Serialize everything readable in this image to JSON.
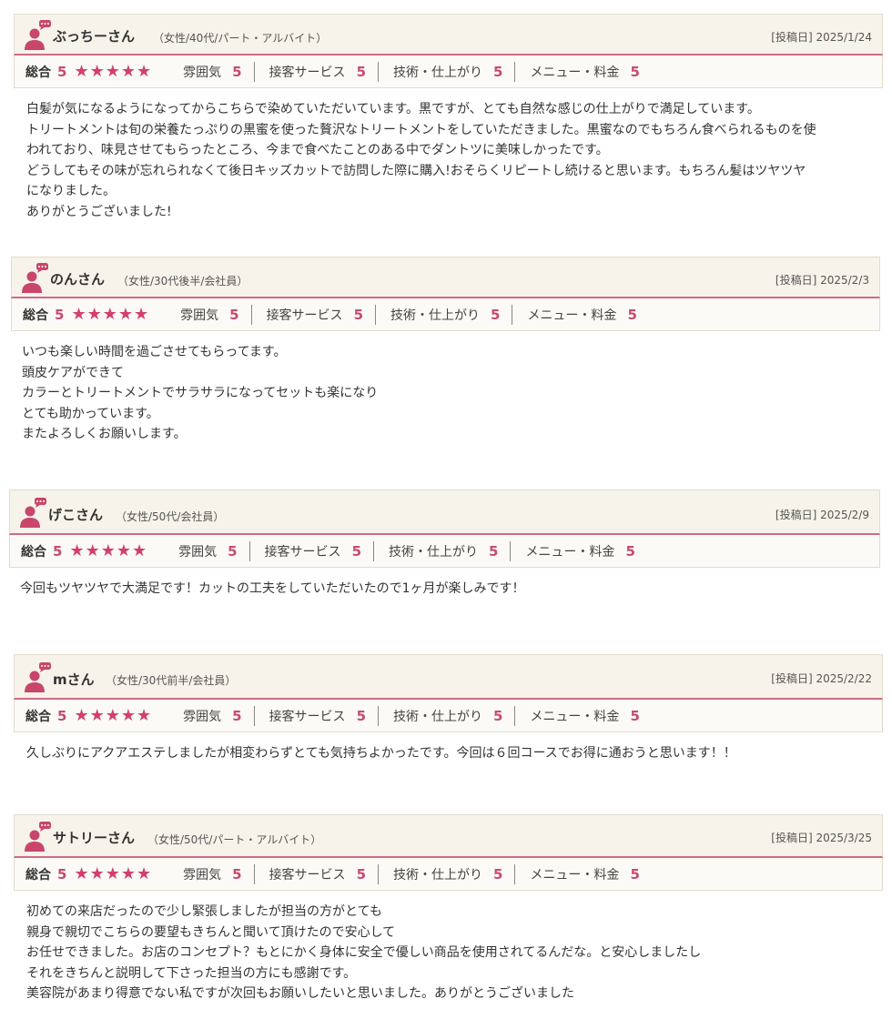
{
  "theme": {
    "accent": "#d06a85",
    "star": "#d23f6d",
    "header_bg": "#f7f3ea"
  },
  "labels": {
    "overall": "総合",
    "atmosphere": "雰囲気",
    "service": "接客サービス",
    "technique": "技術・仕上がり",
    "menu_price": "メニュー・料金",
    "posted_prefix": "[投稿日]",
    "stars": "★★★★★"
  },
  "reviews": [
    {
      "name": "ぶっちーさん",
      "meta": "（女性/40代/パート・アルバイト）",
      "date": "2025/1/24",
      "overall": "5",
      "atmosphere": "5",
      "service": "5",
      "technique": "5",
      "menu_price": "5",
      "lines": [
        "白髪が気になるようになってからこちらで染めていただいています。黒ですが、とても自然な感じの仕上がりで満足しています。",
        "トリートメントは旬の栄養たっぷりの黒蜜を使った贅沢なトリートメントをしていただきました。黒蜜なのでもちろん食べられるものを使",
        "われており、味見させてもらったところ、今まで食べたことのある中でダントツに美味しかったです。",
        "どうしてもその味が忘れられなくて後日キッズカットで訪問した際に購入!おそらくリピートし続けると思います。もちろん髪はツヤツヤ",
        "になりました。",
        "ありがとうございました!"
      ]
    },
    {
      "name": "のんさん",
      "meta": "（女性/30代後半/会社員）",
      "date": "2025/2/3",
      "overall": "5",
      "atmosphere": "5",
      "service": "5",
      "technique": "5",
      "menu_price": "5",
      "lines": [
        "いつも楽しい時間を過ごさせてもらってます。",
        "頭皮ケアができて",
        "カラーとトリートメントでサラサラになってセットも楽になり",
        "とても助かっています。",
        "またよろしくお願いします。"
      ]
    },
    {
      "name": "げこさん",
      "meta": "（女性/50代/会社員）",
      "date": "2025/2/9",
      "overall": "5",
      "atmosphere": "5",
      "service": "5",
      "technique": "5",
      "menu_price": "5",
      "lines": [
        "今回もツヤツヤで大満足です！カットの工夫をしていただいたので1ヶ月が楽しみです！"
      ]
    },
    {
      "name": "mさん",
      "meta": "（女性/30代前半/会社員）",
      "date": "2025/2/22",
      "overall": "5",
      "atmosphere": "5",
      "service": "5",
      "technique": "5",
      "menu_price": "5",
      "lines": [
        "久しぶりにアクアエステしましたが相変わらずとても気持ちよかったです。今回は６回コースでお得に通おうと思います！！"
      ]
    },
    {
      "name": "サトリーさん",
      "meta": "（女性/50代/パート・アルバイト）",
      "date": "2025/3/25",
      "overall": "5",
      "atmosphere": "5",
      "service": "5",
      "technique": "5",
      "menu_price": "5",
      "lines": [
        "初めての来店だったので少し緊張しましたが担当の方がとても",
        "親身で親切でこちらの要望もきちんと聞いて頂けたので安心して",
        "お任せできました。お店のコンセプト？もとにかく身体に安全で優しい商品を使用されてるんだな。と安心しましたし",
        "それをきちんと説明して下さった担当の方にも感謝です。",
        "美容院があまり得意でない私ですが次回もお願いしたいと思いました。ありがとうございました"
      ]
    }
  ]
}
